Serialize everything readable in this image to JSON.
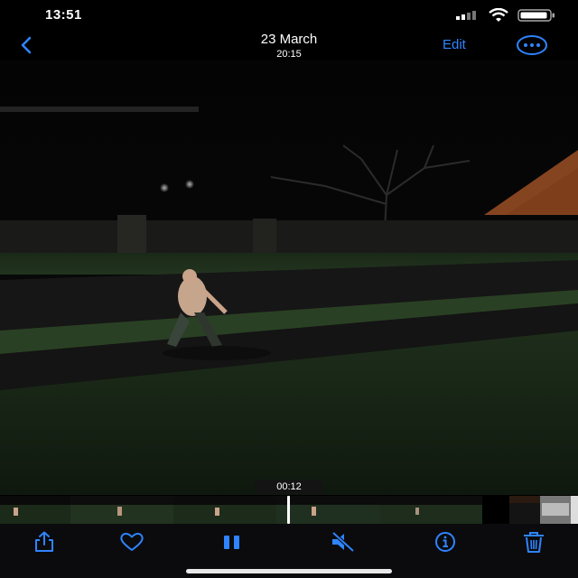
{
  "status_bar": {
    "time": "13:51",
    "signal_icon": "cellular-signal-icon",
    "wifi_icon": "wifi-icon",
    "battery_icon": "battery-icon"
  },
  "nav": {
    "back_icon": "chevron-left-icon",
    "title": "23 March",
    "subtitle": "20:15",
    "edit_label": "Edit",
    "more_icon": "ellipsis-circle-icon"
  },
  "video": {
    "description_icon": "video-frame",
    "timecode": "00:12"
  },
  "filmstrip": {
    "frame_count": 8
  },
  "toolbar": {
    "share_icon": "share-icon",
    "favorite_icon": "heart-icon",
    "pause_icon": "pause-icon",
    "mute_icon": "speaker-muted-icon",
    "info_icon": "info-icon",
    "delete_icon": "trash-icon"
  },
  "colors": {
    "accent": "#2f84ff",
    "background": "#000000"
  }
}
